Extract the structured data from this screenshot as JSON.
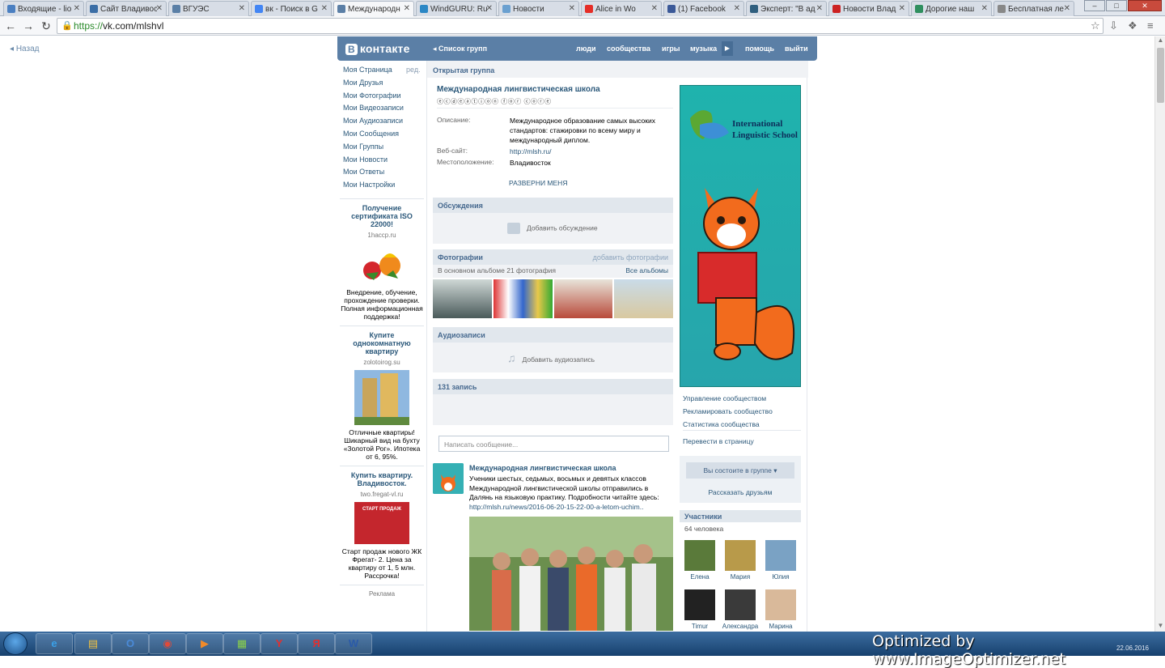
{
  "tabs": [
    {
      "label": "Входящие - lio",
      "color": "#4a7fc1"
    },
    {
      "label": "Сайт Владивос",
      "color": "#3b6ea6"
    },
    {
      "label": "ВГУЭС",
      "color": "#5a7fa6"
    },
    {
      "label": "вк - Поиск в G",
      "color": "#4285f4"
    },
    {
      "label": "Международн",
      "color": "#5b7fa6",
      "active": true
    },
    {
      "label": "WindGURU: Ru",
      "color": "#2b87c5"
    },
    {
      "label": "Новости",
      "color": "#6aa0d0"
    },
    {
      "label": "Alice in Wo",
      "color": "#e52d27"
    },
    {
      "label": "(1) Facebook",
      "color": "#3b5998"
    },
    {
      "label": "Эксперт: \"В ад",
      "color": "#2f5f7f"
    },
    {
      "label": "Новости Влад",
      "color": "#cc2222"
    },
    {
      "label": "Дорогие наш",
      "color": "#2f8f5f"
    },
    {
      "label": "Бесплатная ле",
      "color": "#888888"
    }
  ],
  "address": {
    "scheme": "https://",
    "host": "vk.com/mlshvl"
  },
  "back_link": "Назад",
  "vk": {
    "logo": "ВКонтакте",
    "logo_b": "В",
    "logo_rest": "контакте",
    "group_list": "Список групп",
    "nav": [
      "люди",
      "сообщества",
      "игры",
      "музыка",
      "помощь",
      "выйти"
    ]
  },
  "left_menu": [
    "Моя Страница",
    "Мои Друзья",
    "Мои Фотографии",
    "Мои Видеозаписи",
    "Мои Аудиозаписи",
    "Мои Сообщения",
    "Мои Группы",
    "Мои Новости",
    "Мои Ответы",
    "Мои Настройки"
  ],
  "edit_label": "ред.",
  "ads": [
    {
      "title": "Получение сертификата ISO 22000!",
      "domain": "1haccp.ru",
      "text": "Внедрение, обучение, прохождение проверки. Полная информационная поддержка!"
    },
    {
      "title": "Купите однокомнатную квартиру",
      "domain": "zolotoirog.su",
      "text": "Отличные квартиры! Шикарный вид на бухту «Золотой Рог». Ипотека от 6, 95%."
    },
    {
      "title": "Купить квартиру. Владивосток.",
      "domain": "two.fregat-vl.ru",
      "text": "Старт продаж нового ЖК Фрегат- 2. Цена за квартиру от 1, 5 млн. Рассрочка!",
      "banner": "СТАРТ ПРОДАЖ"
    }
  ],
  "ad_label": "Реклама",
  "group": {
    "type": "Открытая группа",
    "title": "Международная лингвистическая школа",
    "status": "ⓔⓒⓓⓔⓐⓣⓘⓞⓝ ⓕⓞⓡ ⓒⓞⓡⓔ",
    "info": [
      {
        "label": "Описание:",
        "value": "Международное образование самых высоких стандартов: стажировки по всему миру и международный диплом."
      },
      {
        "label": "Веб-сайт:",
        "value": "http://mlsh.ru/"
      },
      {
        "label": "Местоположение:",
        "value": "Владивосток"
      }
    ],
    "expand": "РАЗВЕРНИ МЕНЯ"
  },
  "discussions": {
    "header": "Обсуждения",
    "add": "Добавить обсуждение"
  },
  "photos": {
    "header": "Фотографии",
    "add": "добавить фотографии",
    "album_info": "В основном альбоме 21 фотография",
    "all_albums": "Все альбомы"
  },
  "audio": {
    "header": "Аудиозаписи",
    "add": "Добавить аудиозапись"
  },
  "wall": {
    "count": "131 запись",
    "composer_placeholder": "Написать сообщение..."
  },
  "post": {
    "author": "Международная лингвистическая школа",
    "text": "Ученики шестых, седьмых, восьмых и девятых классов Международной лингвистической школы отправились в Далянь на языковую практику. Подробности читайте здесь:",
    "link": "http://mlsh.ru/news/2016-06-20-15-22-00-a-letom-uchim.."
  },
  "poster": {
    "school_name_line1": "International",
    "school_name_line2": "Linguistic School"
  },
  "right_links": [
    "Управление сообществом",
    "Рекламировать сообщество",
    "Статистика сообщества",
    "Перевести в страницу"
  ],
  "member": {
    "status": "Вы состоите в группе",
    "tell_friends": "Рассказать друзьям"
  },
  "members": {
    "header": "Участники",
    "count": "64 человека",
    "people": [
      {
        "name": "Елена",
        "color": "#5a7a3a"
      },
      {
        "name": "Мария",
        "color": "#b89a4a"
      },
      {
        "name": "Юлия",
        "color": "#7aa2c4"
      },
      {
        "name": "Timur",
        "color": "#222222"
      },
      {
        "name": "Александра",
        "color": "#3a3a3a"
      },
      {
        "name": "Марина",
        "color": "#d9b99a"
      }
    ]
  },
  "taskbar": {
    "watermark": "Optimized by www.ImageOptimizer.net",
    "date": "22.06.2016"
  }
}
